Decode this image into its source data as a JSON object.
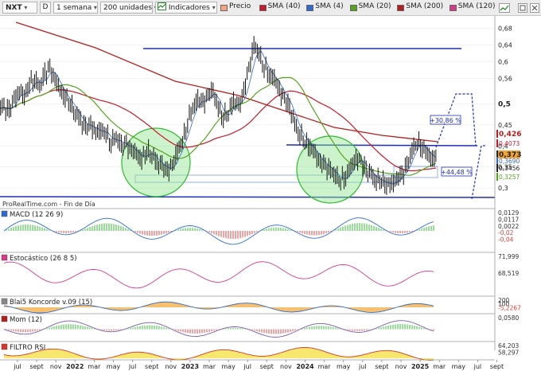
{
  "toolbar": {
    "symbol": "NXT",
    "type_button": "D",
    "period": "1 semana",
    "units": "200 unidades",
    "indicators": "Indicadores",
    "legend": [
      {
        "label": "Precio",
        "color": "#f4a37a"
      },
      {
        "label": "SMA (40)",
        "color": "#c8182a"
      },
      {
        "label": "SMA (4)",
        "color": "#2d6bd2"
      },
      {
        "label": "SMA (20)",
        "color": "#55a51c"
      },
      {
        "label": "SMA (200)",
        "color": "#b81c1c"
      },
      {
        "label": "SMA (120)",
        "color": "#d83a8a"
      }
    ]
  },
  "price_panel": {
    "source_label": "ProRealTime.com - Fin de Día",
    "axis_ticks": [
      "0,68",
      "0,64",
      "0,6",
      "0,56",
      "0,5",
      "0,45",
      "0,4",
      "0,35",
      "0,3"
    ],
    "axis_badges": [
      {
        "text": "0,426",
        "color": "#b81c1c",
        "bold": true
      },
      {
        "text": "0,4073",
        "color": "#c8182a",
        "bold": false
      },
      {
        "text": "0,373",
        "color": "#222222",
        "bold": true,
        "bg": "#f2a531"
      },
      {
        "text": "0,3690",
        "color": "#2d6bd2",
        "bold": false
      },
      {
        "text": "0,3456",
        "color": "#222222",
        "bold": false
      },
      {
        "text": "0,3257",
        "color": "#55a51c",
        "bold": false
      }
    ],
    "annotations": [
      "+30,86 %",
      "+44,48 %"
    ]
  },
  "indicator_panels": [
    {
      "title": "MACD (12 26 9)",
      "values": [
        "0,0129",
        "0,0117",
        "0,0022",
        "-0,02",
        "-0,04"
      ]
    },
    {
      "title": "Estocástico (26 8 5)",
      "values": [
        "71,999",
        "68,519"
      ]
    },
    {
      "title": "Blai5 Koncorde v.09 (15)",
      "values": [
        "200",
        "100",
        "-5,2267"
      ]
    },
    {
      "title": "Mom (12)",
      "values": [
        "0,0580"
      ]
    },
    {
      "title": "FILTRO RSI",
      "values": [
        "64,203",
        "58,297"
      ]
    }
  ],
  "x_axis": [
    {
      "label": "jul",
      "bold": false
    },
    {
      "label": "sept",
      "bold": false
    },
    {
      "label": "nov",
      "bold": false
    },
    {
      "label": "2022",
      "bold": true
    },
    {
      "label": "mar",
      "bold": false
    },
    {
      "label": "may",
      "bold": false
    },
    {
      "label": "jul",
      "bold": false
    },
    {
      "label": "sept",
      "bold": false
    },
    {
      "label": "nov",
      "bold": false
    },
    {
      "label": "2023",
      "bold": true
    },
    {
      "label": "mar",
      "bold": false
    },
    {
      "label": "may",
      "bold": false
    },
    {
      "label": "jul",
      "bold": false
    },
    {
      "label": "sept",
      "bold": false
    },
    {
      "label": "nov",
      "bold": false
    },
    {
      "label": "2024",
      "bold": true
    },
    {
      "label": "mar",
      "bold": false
    },
    {
      "label": "may",
      "bold": false
    },
    {
      "label": "jul",
      "bold": false
    },
    {
      "label": "sept",
      "bold": false
    },
    {
      "label": "nov",
      "bold": false
    },
    {
      "label": "2025",
      "bold": true
    },
    {
      "label": "mar",
      "bold": false
    },
    {
      "label": "may",
      "bold": false
    },
    {
      "label": "jul",
      "bold": false
    },
    {
      "label": "sept",
      "bold": false
    }
  ],
  "chart_data": {
    "type": "line",
    "y_range": [
      0.27,
      0.69
    ],
    "weekly_close_approx": [
      0.49,
      0.48,
      0.51,
      0.53,
      0.52,
      0.55,
      0.56,
      0.54,
      0.57,
      0.58,
      0.56,
      0.53,
      0.52,
      0.5,
      0.48,
      0.46,
      0.44,
      0.45,
      0.43,
      0.44,
      0.43,
      0.41,
      0.42,
      0.4,
      0.4,
      0.39,
      0.38,
      0.37,
      0.39,
      0.38,
      0.36,
      0.35,
      0.34,
      0.35,
      0.39,
      0.41,
      0.46,
      0.49,
      0.51,
      0.5,
      0.52,
      0.53,
      0.49,
      0.47,
      0.48,
      0.51,
      0.49,
      0.53,
      0.58,
      0.64,
      0.62,
      0.59,
      0.57,
      0.56,
      0.53,
      0.51,
      0.49,
      0.45,
      0.43,
      0.41,
      0.4,
      0.38,
      0.36,
      0.35,
      0.34,
      0.33,
      0.32,
      0.33,
      0.35,
      0.37,
      0.36,
      0.34,
      0.33,
      0.32,
      0.32,
      0.31,
      0.31,
      0.32,
      0.33,
      0.35,
      0.39,
      0.41,
      0.4,
      0.38,
      0.37,
      0.373
    ]
  }
}
